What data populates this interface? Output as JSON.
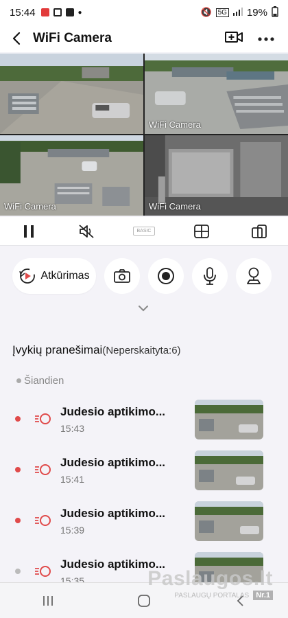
{
  "status_bar": {
    "time": "15:44",
    "battery": "19%",
    "network": "5G",
    "colors": {
      "red_icon": "#e23b3b"
    }
  },
  "header": {
    "title": "WiFi Camera",
    "back_icon": "arrow-left-icon",
    "add_camera_icon": "camera-plus-icon",
    "more_icon": "more-dots-icon"
  },
  "cameras": [
    {
      "label": "",
      "selected": true
    },
    {
      "label": "WiFi Camera",
      "selected": false
    },
    {
      "label": "WiFi Camera",
      "selected": false
    },
    {
      "label": "WiFi Camera",
      "selected": false
    }
  ],
  "controls": {
    "pause_icon": "pause-icon",
    "mute_icon": "speaker-muted-icon",
    "quality_label": "BASIC",
    "layout_icon": "grid-layout-icon",
    "screen_icon": "screen-switch-icon"
  },
  "actions": {
    "playback_label": "Atkūrimas",
    "snapshot_icon": "camera-icon",
    "record_icon": "record-icon",
    "mic_icon": "microphone-icon",
    "ptz_icon": "ptz-joystick-icon"
  },
  "events": {
    "title": "Įvykių pranešimai",
    "unread": "(Neperskaityta:6)",
    "section": "Šiandien",
    "items": [
      {
        "title": "Judesio aptikimo...",
        "time": "15:43",
        "unread": true
      },
      {
        "title": "Judesio aptikimo...",
        "time": "15:41",
        "unread": true
      },
      {
        "title": "Judesio aptikimo...",
        "time": "15:39",
        "unread": true
      },
      {
        "title": "Judesio aptikimo...",
        "time": "15:35",
        "unread": false
      }
    ]
  },
  "watermark": {
    "brand": "Paslaugos.lt",
    "tagline": "PASLAUGŲ PORTALAS",
    "badge": "Nr.1"
  },
  "theme": {
    "accent": "#e04a4a",
    "background": "#f4f3f8"
  }
}
